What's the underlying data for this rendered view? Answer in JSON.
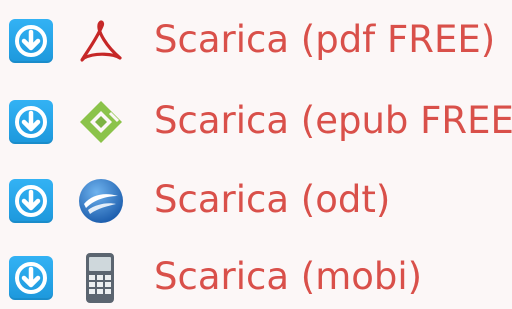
{
  "colors": {
    "link": "#d9504a",
    "button": "#22a2e6",
    "background": "#fcf7f7"
  },
  "downloads": [
    {
      "label": "Scarica (pdf FREE)",
      "icon": "pdf-icon"
    },
    {
      "label": "Scarica (epub FREE)",
      "icon": "epub-icon"
    },
    {
      "label": "Scarica (odt)",
      "icon": "odt-icon"
    },
    {
      "label": "Scarica (mobi)",
      "icon": "mobi-icon"
    }
  ]
}
